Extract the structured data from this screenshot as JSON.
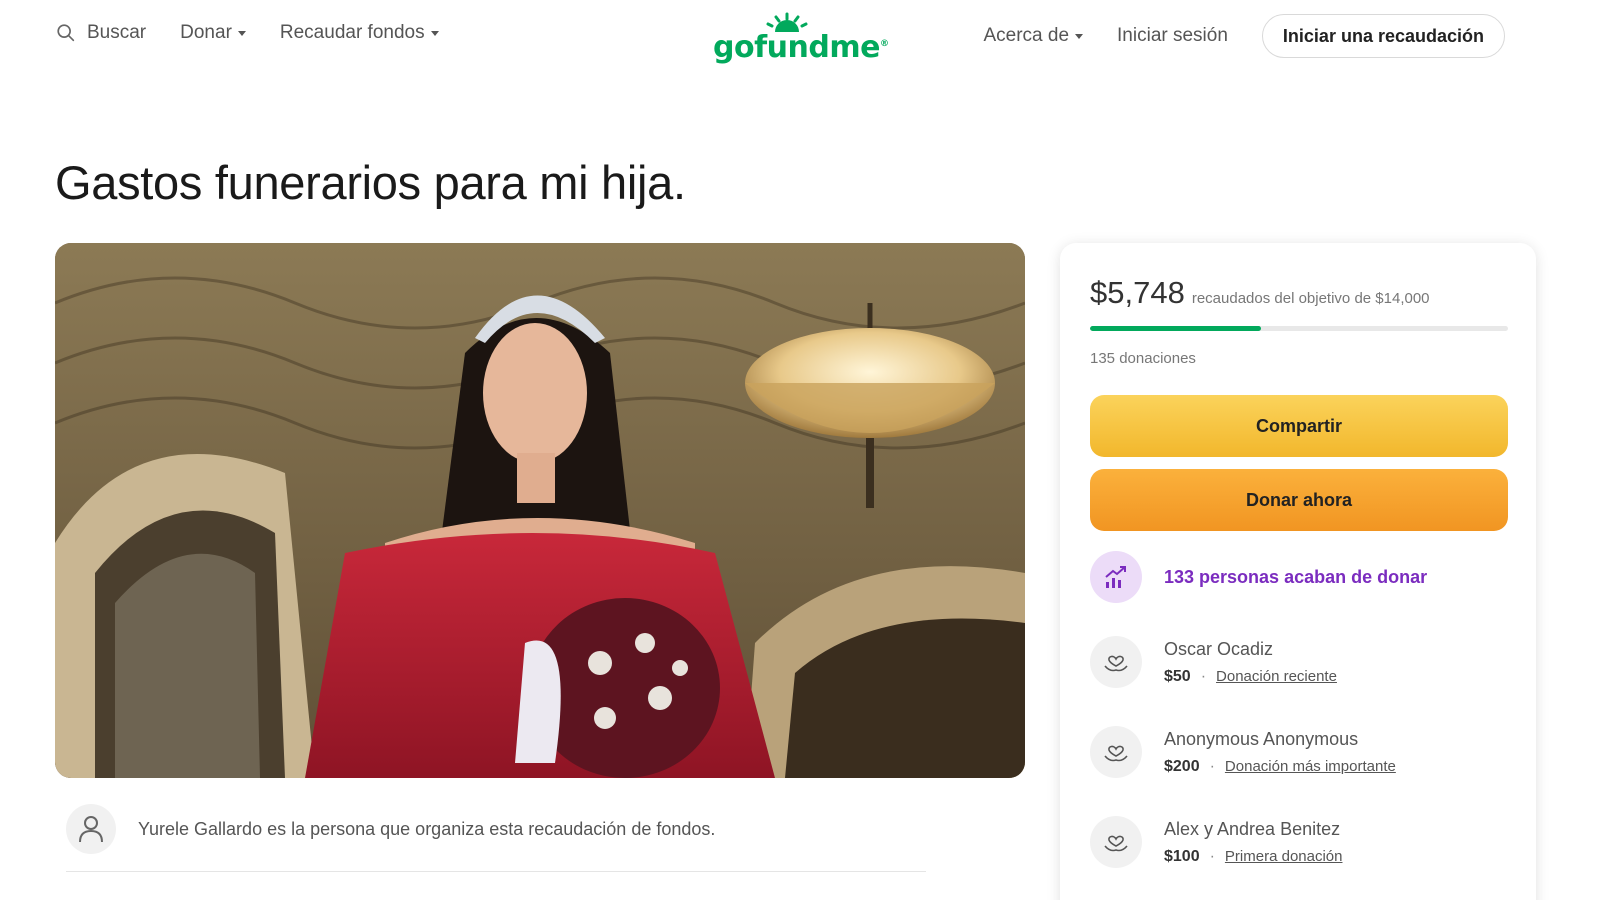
{
  "header": {
    "search_label": "Buscar",
    "donate_label": "Donar",
    "fundraise_label": "Recaudar fondos",
    "logo_text": "gofundme",
    "about_label": "Acerca de",
    "login_label": "Iniciar sesión",
    "start_label": "Iniciar una recaudación"
  },
  "campaign": {
    "title": "Gastos funerarios para mi hija.",
    "organizer_text": "Yurele Gallardo es la persona que organiza esta recaudación de fondos."
  },
  "donation_card": {
    "raised": "$5,748",
    "goal_text": "recaudados del objetivo de $14,000",
    "progress_fraction": 0.41,
    "donation_count": "135 donaciones",
    "share_label": "Compartir",
    "donate_label": "Donar ahora",
    "recent_text": "133 personas acaban de donar",
    "donors": [
      {
        "name": "Oscar Ocadiz",
        "amount": "$50",
        "tag": "Donación reciente"
      },
      {
        "name": "Anonymous Anonymous",
        "amount": "$200",
        "tag": "Donación más importante"
      },
      {
        "name": "Alex y Andrea Benitez",
        "amount": "$100",
        "tag": "Primera donación"
      }
    ]
  },
  "colors": {
    "brand_green": "#02a95c",
    "share_yellow": "#f7c443",
    "donate_orange": "#f5a32e",
    "recent_purple": "#7b2cbf"
  },
  "icons": [
    "search-icon",
    "caret-down-icon",
    "user-icon",
    "trending-icon",
    "heart-hands-icon"
  ]
}
